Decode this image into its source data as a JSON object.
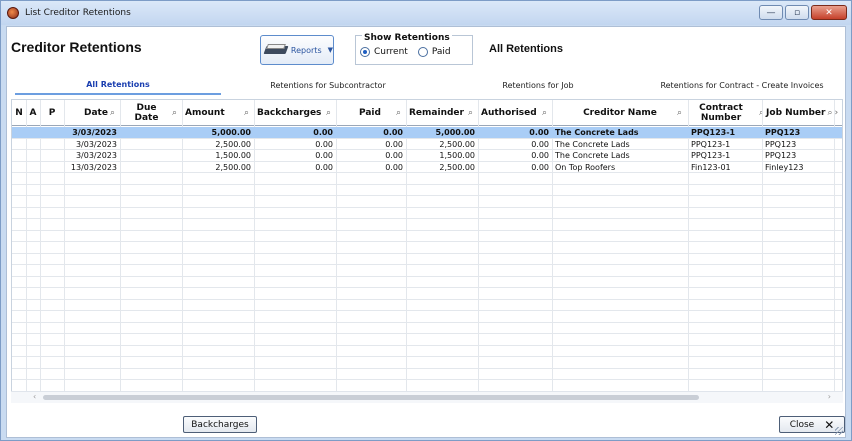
{
  "window": {
    "title": "List Creditor Retentions"
  },
  "header": {
    "title": "Creditor Retentions",
    "reports_label": "Reports",
    "show_retentions": {
      "label": "Show Retentions",
      "current": "Current",
      "paid": "Paid",
      "selected": "Current"
    },
    "view_title": "All Retentions"
  },
  "tabs": [
    {
      "label": "All Retentions",
      "active": true
    },
    {
      "label": "Retentions for Subcontractor",
      "active": false
    },
    {
      "label": "Retentions for Job",
      "active": false
    },
    {
      "label": "Retentions for Contract - Create Invoices",
      "active": false
    }
  ],
  "columns": {
    "n": "N",
    "a": "A",
    "p": "P",
    "date": "Date",
    "due_date": "Due Date",
    "amount": "Amount",
    "backcharges": "Backcharges",
    "paid": "Paid",
    "remainder": "Remainder",
    "authorised": "Authorised",
    "creditor_name": "Creditor Name",
    "contract_number": "Contract Number",
    "job_number": "Job Number"
  },
  "rows": [
    {
      "date": "3/03/2023",
      "due_date": "",
      "amount": "5,000.00",
      "backcharges": "0.00",
      "paid": "0.00",
      "remainder": "5,000.00",
      "authorised": "0.00",
      "creditor_name": "The Concrete Lads",
      "contract_number": "PPQ123-1",
      "job_number": "PPQ123"
    },
    {
      "date": "3/03/2023",
      "due_date": "",
      "amount": "2,500.00",
      "backcharges": "0.00",
      "paid": "0.00",
      "remainder": "2,500.00",
      "authorised": "0.00",
      "creditor_name": "The Concrete Lads",
      "contract_number": "PPQ123-1",
      "job_number": "PPQ123"
    },
    {
      "date": "3/03/2023",
      "due_date": "",
      "amount": "1,500.00",
      "backcharges": "0.00",
      "paid": "0.00",
      "remainder": "1,500.00",
      "authorised": "0.00",
      "creditor_name": "The Concrete Lads",
      "contract_number": "PPQ123-1",
      "job_number": "PPQ123"
    },
    {
      "date": "13/03/2023",
      "due_date": "",
      "amount": "2,500.00",
      "backcharges": "0.00",
      "paid": "0.00",
      "remainder": "2,500.00",
      "authorised": "0.00",
      "creditor_name": "On Top Roofers",
      "contract_number": "Fin123-01",
      "job_number": "Finley123"
    }
  ],
  "footer": {
    "backcharges_label": "Backcharges",
    "close_label": "Close"
  }
}
